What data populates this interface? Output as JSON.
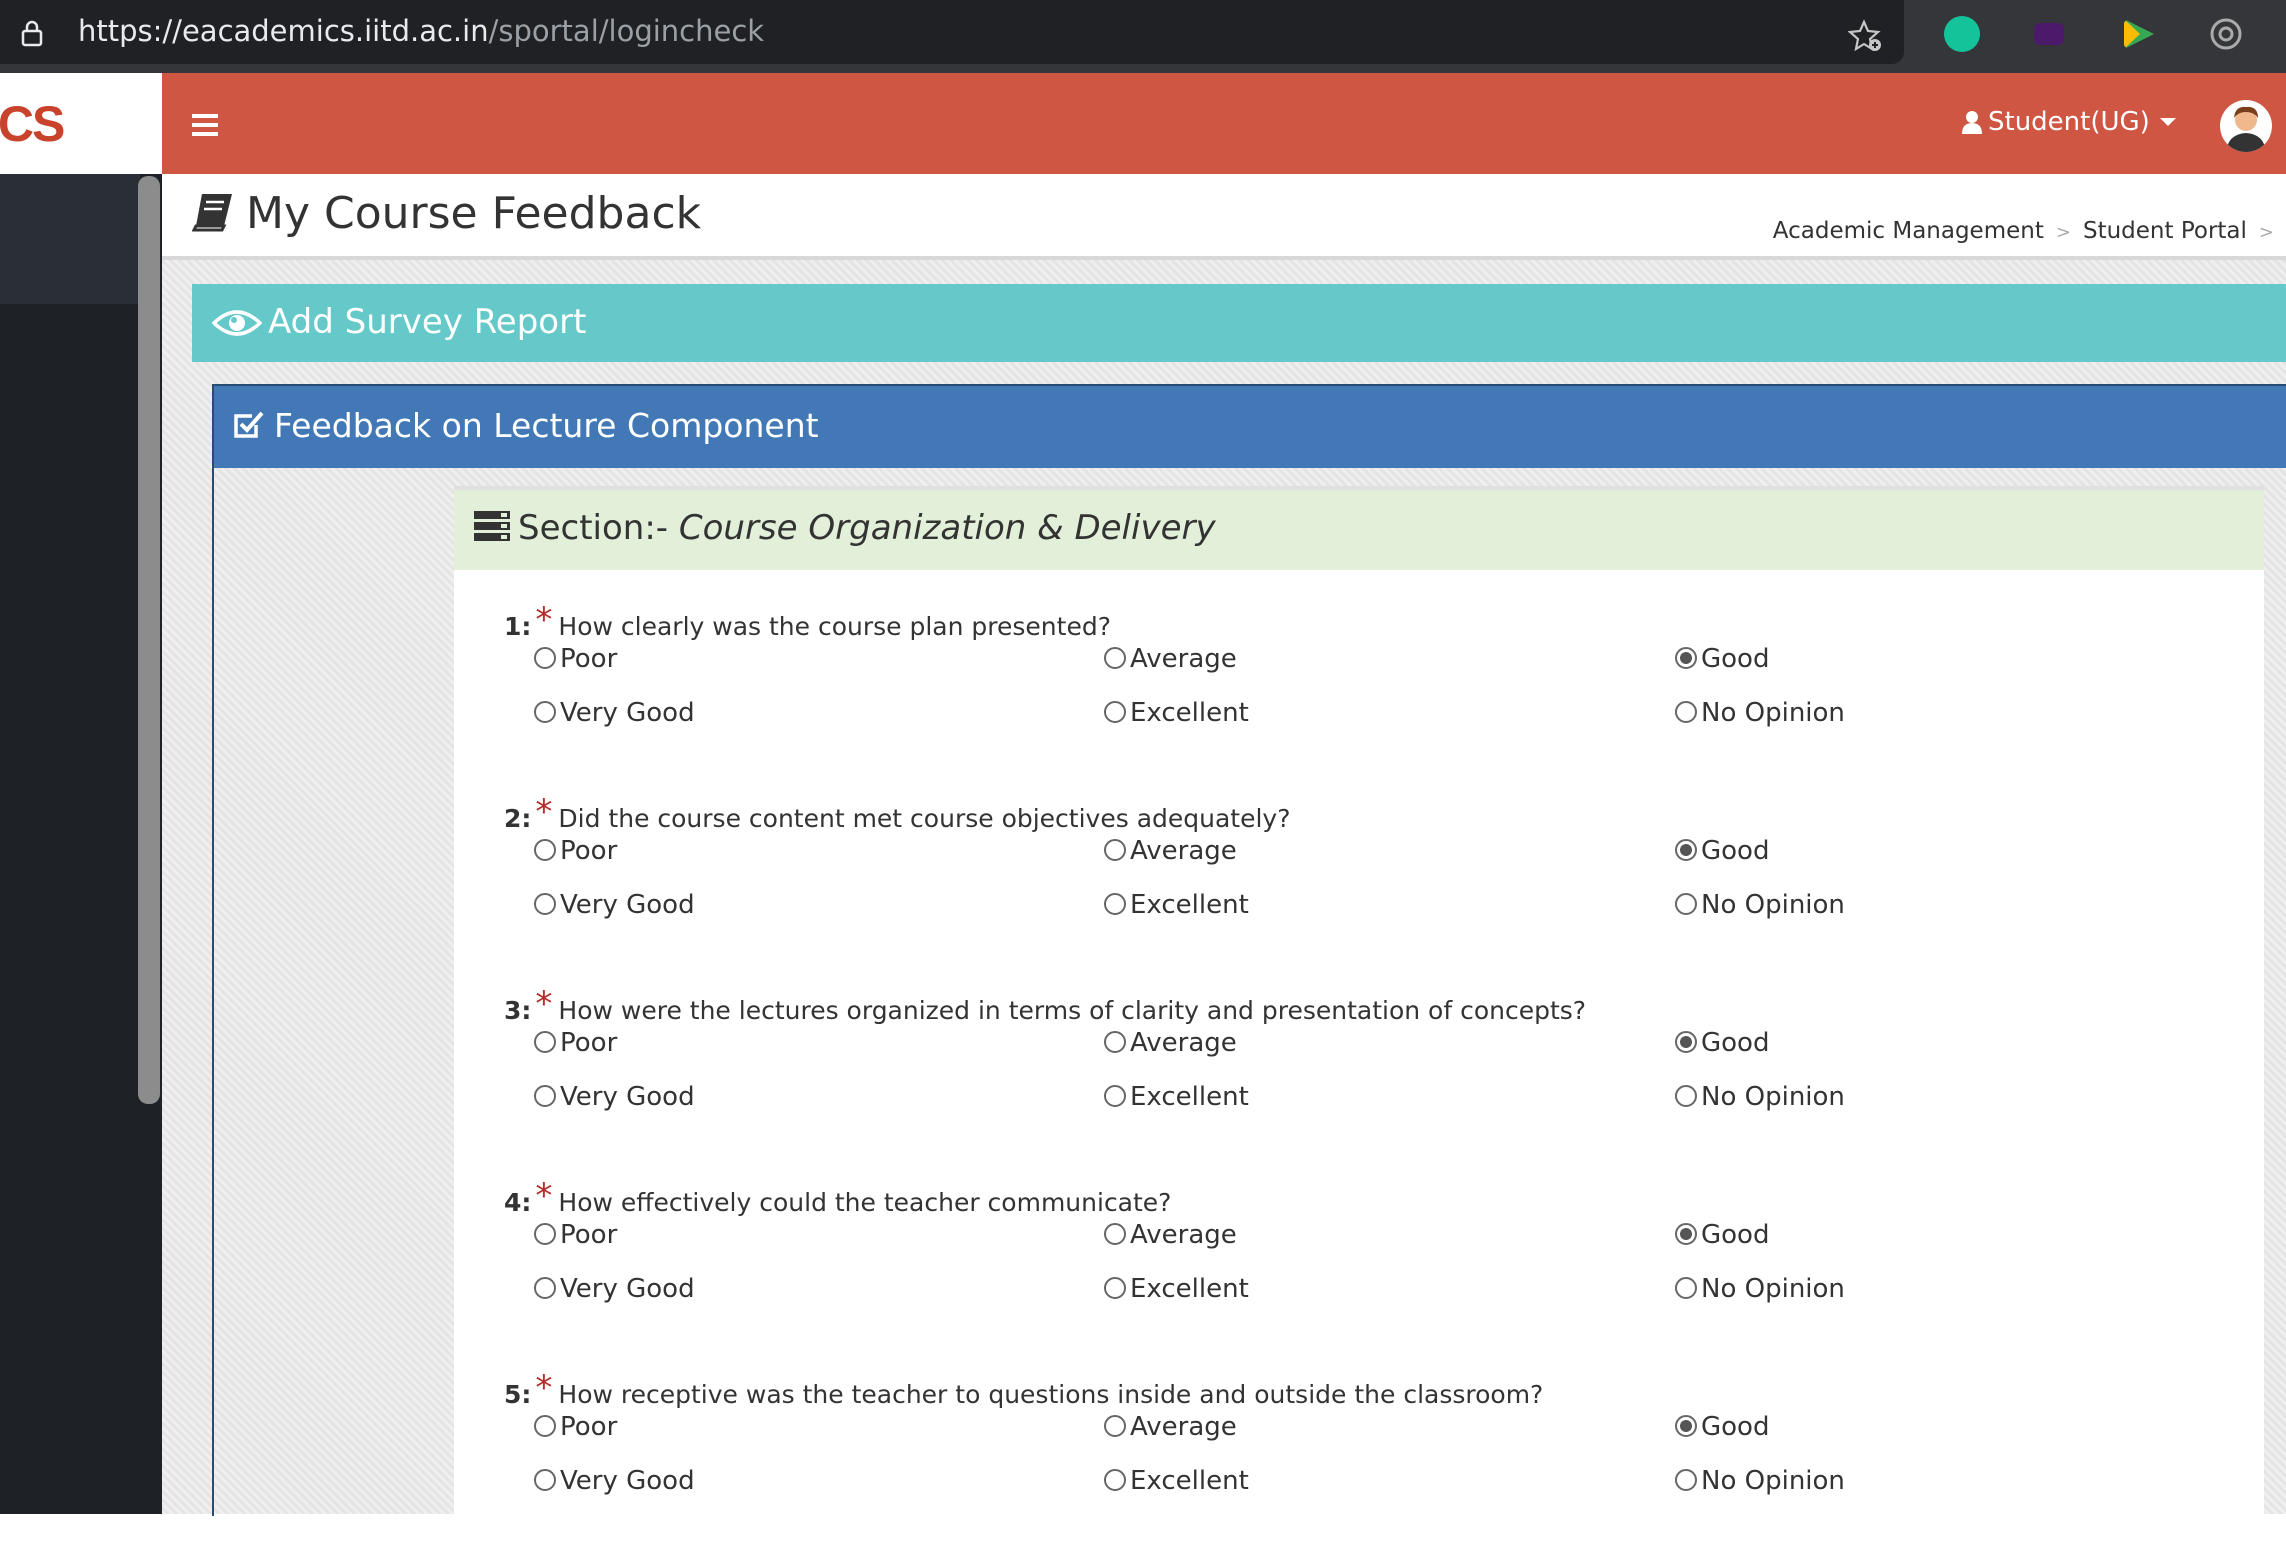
{
  "browser": {
    "url_host": "https://eacademics.iitd.ac.in",
    "url_path": "/sportal/logincheck"
  },
  "header": {
    "logo": "ICS",
    "role_label": "Student(UG)"
  },
  "page": {
    "title": "My Course Feedback",
    "breadcrumbs": [
      "Academic Management",
      "Student Portal"
    ]
  },
  "survey": {
    "title": "Add Survey Report",
    "panel_title": "Feedback on Lecture Component",
    "section_prefix": "Section:-",
    "section_name": "Course Organization & Delivery"
  },
  "questions": [
    {
      "num": "1:",
      "text": "How clearly was the course plan presented?",
      "selected": "Good"
    },
    {
      "num": "2:",
      "text": "Did the course content met course objectives adequately?",
      "selected": "Good"
    },
    {
      "num": "3:",
      "text": "How were the lectures organized in terms of clarity and presentation of concepts?",
      "selected": "Good"
    },
    {
      "num": "4:",
      "text": "How effectively could the teacher communicate?",
      "selected": "Good"
    },
    {
      "num": "5:",
      "text": "How receptive was the teacher to questions inside and outside the classroom?",
      "selected": "Good"
    }
  ],
  "options": [
    "Poor",
    "Average",
    "Good",
    "Very Good",
    "Excellent",
    "No Opinion"
  ],
  "required_mark": "*",
  "colors": {
    "topnav": "#cf5643",
    "survey_bar": "#66c9c9",
    "panel_header": "#4278b6",
    "section_header": "#e2f0da",
    "sidebar": "#1e2226"
  }
}
